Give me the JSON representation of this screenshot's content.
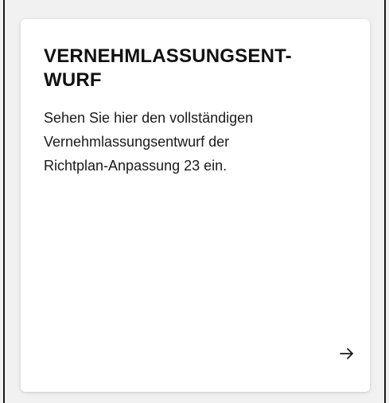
{
  "card": {
    "title_lines": [
      "VERNEHMLASSUNGSENT-",
      "WURF"
    ],
    "description_lines": [
      "Sehen Sie hier den vollständigen",
      "Vernehmlassungsentwurf der",
      "Richtplan-Anpassung 23 ein."
    ],
    "arrow_icon": "arrow-right-icon",
    "background": "#ffffff",
    "text_color": "#111111"
  }
}
